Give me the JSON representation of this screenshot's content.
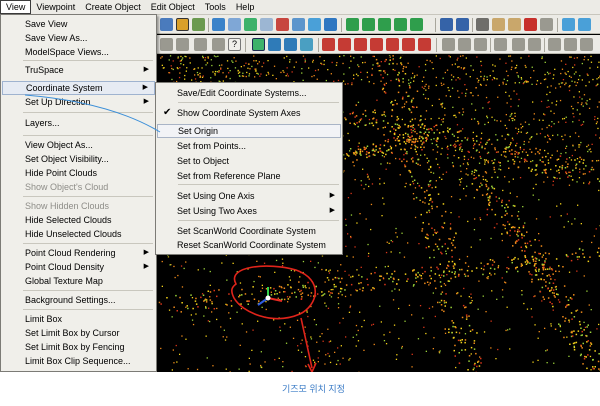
{
  "menubar": {
    "items": [
      "View",
      "Viewpoint",
      "Create Object",
      "Edit Object",
      "Tools",
      "Help"
    ]
  },
  "view_menu": {
    "items": [
      {
        "label": "Save View",
        "disabled": false,
        "arrow": false
      },
      {
        "label": "Save View As...",
        "disabled": false,
        "arrow": false
      },
      {
        "label": "ModelSpace Views...",
        "disabled": false,
        "arrow": false
      },
      {
        "label": "TruSpace",
        "disabled": false,
        "arrow": true
      },
      {
        "label": "Coordinate System",
        "disabled": false,
        "arrow": true,
        "highlight": true
      },
      {
        "label": "Set Up Direction",
        "disabled": false,
        "arrow": true
      },
      {
        "label": "Layers...",
        "disabled": false,
        "arrow": false
      },
      {
        "label": "View Object As...",
        "disabled": false,
        "arrow": false
      },
      {
        "label": "Set Object Visibility...",
        "disabled": false,
        "arrow": false
      },
      {
        "label": "Hide Point Clouds",
        "disabled": false,
        "arrow": false
      },
      {
        "label": "Show Object's Cloud",
        "disabled": true,
        "arrow": false
      },
      {
        "label": "Show Hidden Clouds",
        "disabled": true,
        "arrow": false
      },
      {
        "label": "Hide Selected Clouds",
        "disabled": false,
        "arrow": false
      },
      {
        "label": "Hide Unselected Clouds",
        "disabled": false,
        "arrow": false
      },
      {
        "label": "Point Cloud Rendering",
        "disabled": false,
        "arrow": true
      },
      {
        "label": "Point Cloud Density",
        "disabled": false,
        "arrow": true
      },
      {
        "label": "Global Texture Map",
        "disabled": false,
        "arrow": false
      },
      {
        "label": "Background Settings...",
        "disabled": false,
        "arrow": false
      },
      {
        "label": "Limit Box",
        "disabled": false,
        "arrow": false
      },
      {
        "label": "Set Limit Box by Cursor",
        "disabled": false,
        "arrow": false
      },
      {
        "label": "Set Limit Box by Fencing",
        "disabled": false,
        "arrow": false
      },
      {
        "label": "Limit Box Clip Sequence...",
        "disabled": false,
        "arrow": false
      }
    ]
  },
  "submenu": {
    "items": [
      {
        "label": "Save/Edit Coordinate Systems...",
        "checked": false,
        "arrow": false
      },
      {
        "label": "Show Coordinate System Axes",
        "checked": true,
        "arrow": false
      },
      {
        "label": "Set Origin",
        "checked": false,
        "arrow": false,
        "highlight": true
      },
      {
        "label": "Set from Points...",
        "checked": false,
        "arrow": false
      },
      {
        "label": "Set to Object",
        "checked": false,
        "arrow": false
      },
      {
        "label": "Set from Reference Plane",
        "checked": false,
        "arrow": false
      },
      {
        "label": "Set Using One Axis",
        "checked": false,
        "arrow": true
      },
      {
        "label": "Set Using Two Axes",
        "checked": false,
        "arrow": true
      },
      {
        "label": "Set ScanWorld Coordinate System",
        "checked": false,
        "arrow": false
      },
      {
        "label": "Reset ScanWorld Coordinate System",
        "checked": false,
        "arrow": false
      }
    ]
  },
  "annotation": {
    "caption": "기즈모 위치 지정",
    "circle_color": "#e0241b",
    "leader_color": "#3c8fd8"
  },
  "colors": {
    "menubar_bg": "#ecebe6",
    "menu_bg": "#f0efea",
    "highlight_border": "#9fb3cf",
    "cloud_yellow": "#f3d21a",
    "cloud_orange": "#f08a1a",
    "cloud_red": "#d9361a",
    "cloud_green": "#9bd23a"
  }
}
